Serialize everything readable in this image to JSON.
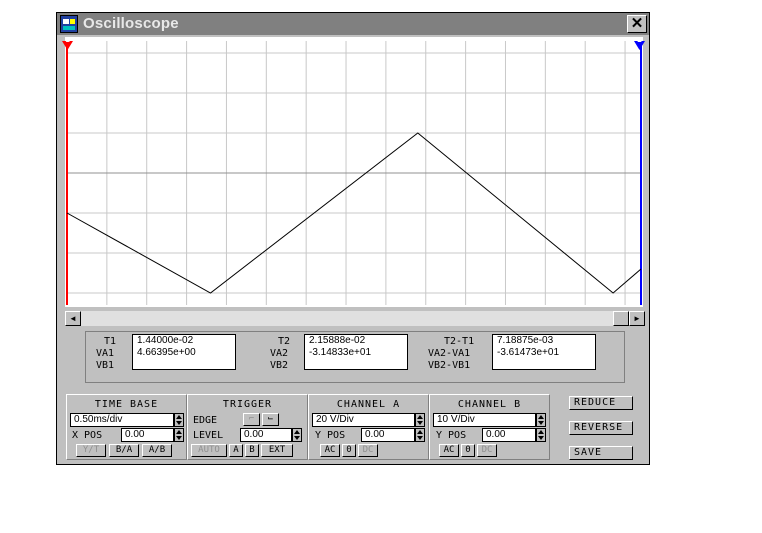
{
  "window": {
    "title": "Oscilloscope",
    "close_glyph": "✕"
  },
  "screen": {
    "marker_left": "1",
    "marker_right": "2",
    "colors": {
      "grid": "#c8c8c8",
      "trace": "#000000",
      "t1": "#ff0000",
      "t2": "#0000ff"
    },
    "trace_points_div": [
      [
        0,
        -1
      ],
      [
        3.6,
        -3
      ],
      [
        8.8,
        1
      ],
      [
        13.7,
        -3
      ],
      [
        14.4,
        -2.4
      ]
    ]
  },
  "scrollbar": {
    "left_arrow": "◄",
    "right_arrow": "►"
  },
  "readout": {
    "t1_label": "T1",
    "va1_label": "VA1",
    "vb1_label": "VB1",
    "t1": "1.44000e-02",
    "va1": "4.66395e+00",
    "vb1": "",
    "t2_label": "T2",
    "va2_label": "VA2",
    "vb2_label": "VB2",
    "t2": "2.15888e-02",
    "va2": "-3.14833e+01",
    "vb2": "",
    "dt_label": "T2-T1",
    "dva_label": "VA2-VA1",
    "dvb_label": "VB2-VB1",
    "dt": "7.18875e-03",
    "dva": "-3.61473e+01",
    "dvb": ""
  },
  "timebase": {
    "title": "TIME BASE",
    "value": "0.50ms/div",
    "xpos_label": "X POS",
    "xpos": "0.00",
    "btn_yt": "Y/T",
    "btn_ba": "B/A",
    "btn_ab": "A/B"
  },
  "trigger": {
    "title": "TRIGGER",
    "edge_label": "EDGE",
    "edge_rise": "⌐",
    "edge_fall": "⌙",
    "level_label": "LEVEL",
    "level": "0.00",
    "btn_auto": "AUTO",
    "btn_a": "A",
    "btn_b": "B",
    "btn_ext": "EXT"
  },
  "channel_a": {
    "title": "CHANNEL A",
    "scale": "20 V/Div",
    "ypos_label": "Y POS",
    "ypos": "0.00",
    "btn_ac": "AC",
    "btn_0": "0",
    "btn_dc": "DC"
  },
  "channel_b": {
    "title": "CHANNEL B",
    "scale": "10 V/Div",
    "ypos_label": "Y POS",
    "ypos": "0.00",
    "btn_ac": "AC",
    "btn_0": "0",
    "btn_dc": "DC"
  },
  "actions": {
    "reduce": "REDUCE",
    "reverse": "REVERSE",
    "save": "SAVE"
  }
}
